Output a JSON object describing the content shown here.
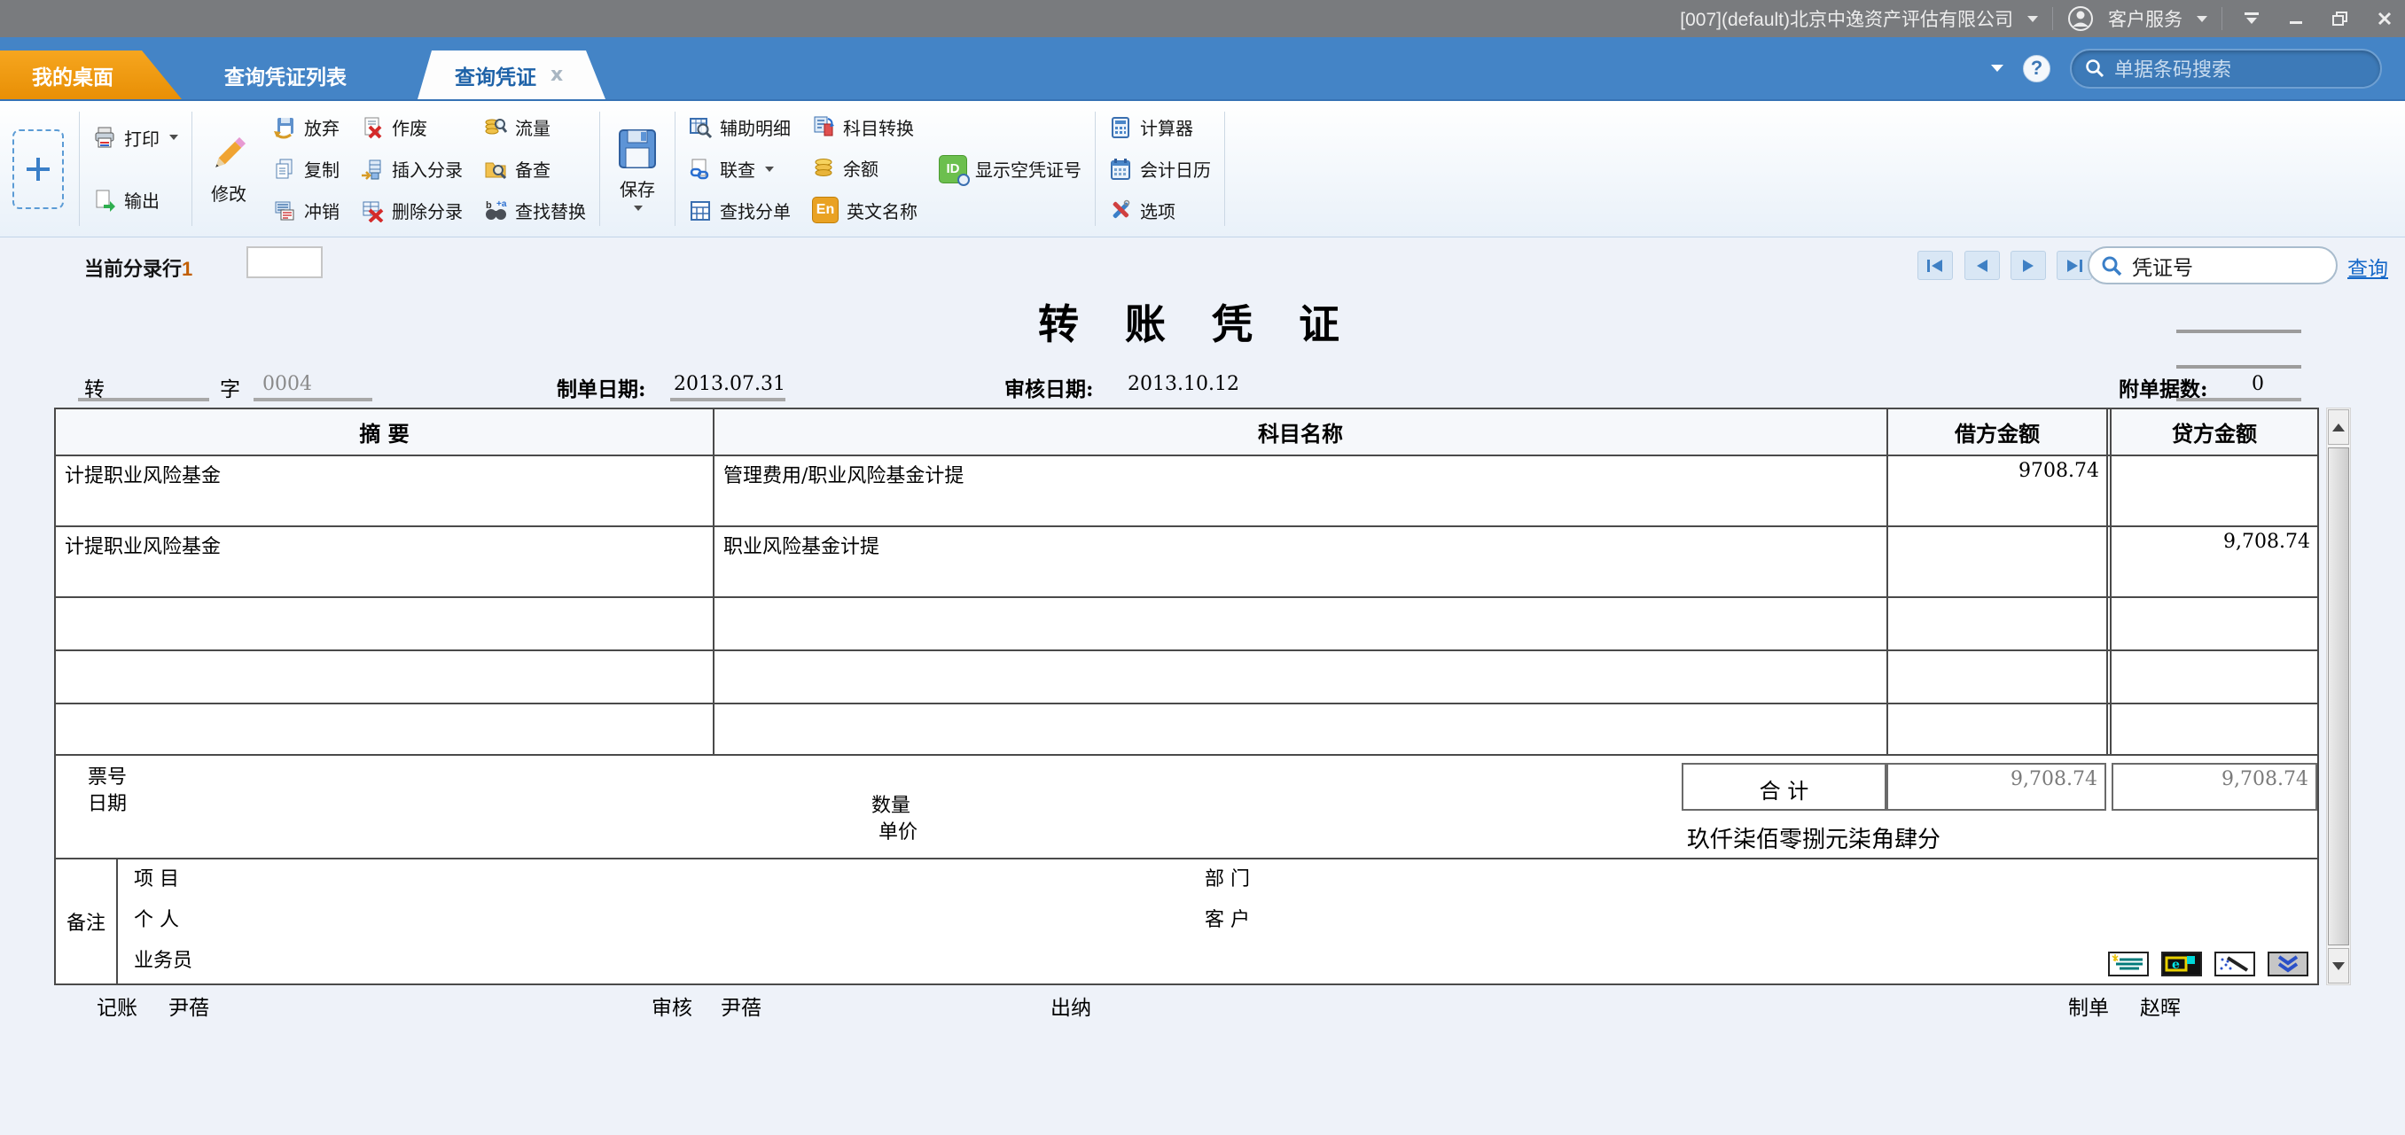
{
  "colors": {
    "tab_orange": "#ef9417",
    "bar_blue": "#4484c6",
    "titlebar_gray": "#797b7e",
    "active_tab_text": "#1e62a8",
    "link_blue": "#1668c8"
  },
  "title_bar": {
    "company": "[007](default)北京中逸资产评估有限公司",
    "service_label": "客户服务"
  },
  "tab_bar": {
    "tabs": [
      {
        "label": "我的桌面"
      },
      {
        "label": "查询凭证列表"
      },
      {
        "label": "查询凭证"
      }
    ],
    "search_placeholder": "单据条码搜索"
  },
  "toolbar": {
    "print": "打印",
    "export": "输出",
    "modify": "修改",
    "abandon": "放弃",
    "copy": "复制",
    "writeoff": "冲销",
    "void_doc": "作废",
    "insert_entry": "插入分录",
    "delete_entry": "删除分录",
    "flow": "流量",
    "reference": "备查",
    "find_replace": "查找替换",
    "save": "保存",
    "aux_detail": "辅助明细",
    "linked_query": "联查",
    "find_split": "查找分单",
    "subject_convert": "科目转换",
    "balance": "余额",
    "english_name": "英文名称",
    "show_empty_no": "显示空凭证号",
    "calculator": "计算器",
    "calendar": "会计日历",
    "options": "选项"
  },
  "status_row": {
    "current_entry_label": "当前分录行",
    "current_entry_value": "1",
    "voucher_no_placeholder": "凭证号",
    "query_link": "查询"
  },
  "voucher": {
    "title": "转 账 凭 证",
    "word_prefix": "转",
    "word_suffix": "字",
    "word_no": "0004",
    "made_date_label": "制单日期:",
    "made_date": "2013.07.31",
    "audit_date_label": "审核日期:",
    "audit_date": "2013.10.12",
    "attach_label": "附单据数:",
    "attach_count": "0",
    "columns": {
      "summary": "摘 要",
      "account": "科目名称",
      "debit": "借方金额",
      "credit": "贷方金额"
    },
    "rows": [
      {
        "summary": "计提职业风险基金",
        "account": "管理费用/职业风险基金计提",
        "debit": "9708.74",
        "credit": ""
      },
      {
        "summary": "计提职业风险基金",
        "account": "职业风险基金计提",
        "debit": "",
        "credit": "9,708.74"
      },
      {
        "summary": "",
        "account": "",
        "debit": "",
        "credit": ""
      },
      {
        "summary": "",
        "account": "",
        "debit": "",
        "credit": ""
      },
      {
        "summary": "",
        "account": "",
        "debit": "",
        "credit": ""
      }
    ],
    "ticket_label": "票号",
    "date_label": "日期",
    "qty_label": "数量",
    "price_label": "单价",
    "total_label": "合 计",
    "total_debit": "9,708.74",
    "total_credit": "9,708.74",
    "amount_in_words": "玖仟柒佰零捌元柒角肆分",
    "remark_label": "备注",
    "project_label": "项 目",
    "person_label": "个 人",
    "salesman_label": "业务员",
    "dept_label": "部 门",
    "customer_label": "客 户"
  },
  "signatures": {
    "book_label": "记账",
    "book_name": "尹蓓",
    "audit_label": "审核",
    "audit_name": "尹蓓",
    "cashier_label": "出纳",
    "cashier_name": "",
    "made_label": "制单",
    "made_name": "赵晖"
  }
}
